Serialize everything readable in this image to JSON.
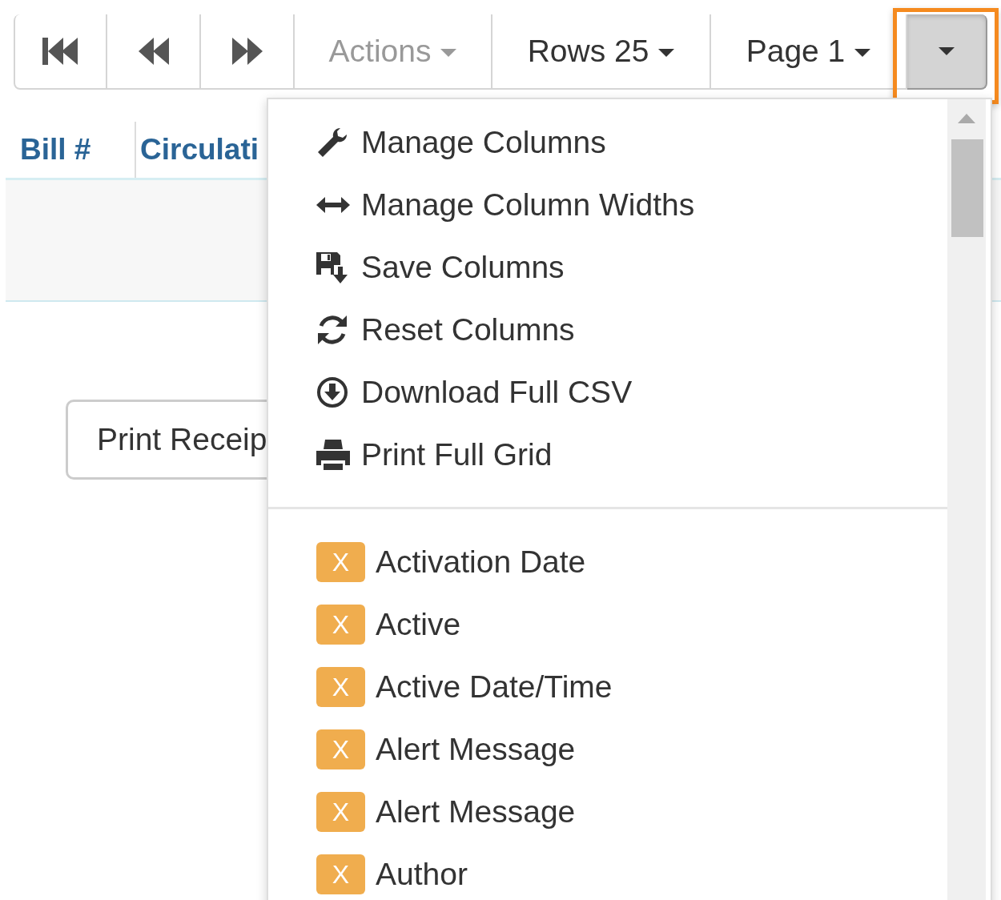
{
  "toolbar": {
    "menus": [
      {
        "label": "Actions",
        "disabled": true
      },
      {
        "label": "Rows 25",
        "disabled": false
      },
      {
        "label": "Page 1",
        "disabled": false
      }
    ],
    "toggle": {
      "focused": true,
      "expanded": true
    }
  },
  "table": {
    "columns": [
      "Bill #",
      "Circulati"
    ]
  },
  "print_button": "Print Receip",
  "dropdown": {
    "actions": [
      "Manage Columns",
      "Manage Column Widths",
      "Save Columns",
      "Reset Columns",
      "Download Full CSV",
      "Print Full Grid"
    ],
    "columns": [
      {
        "badge": "X",
        "label": "Activation Date"
      },
      {
        "badge": "X",
        "label": "Active"
      },
      {
        "badge": "X",
        "label": "Active Date/Time"
      },
      {
        "badge": "X",
        "label": "Alert Message"
      },
      {
        "badge": "X",
        "label": "Alert Message"
      },
      {
        "badge": "X",
        "label": "Author"
      }
    ]
  }
}
